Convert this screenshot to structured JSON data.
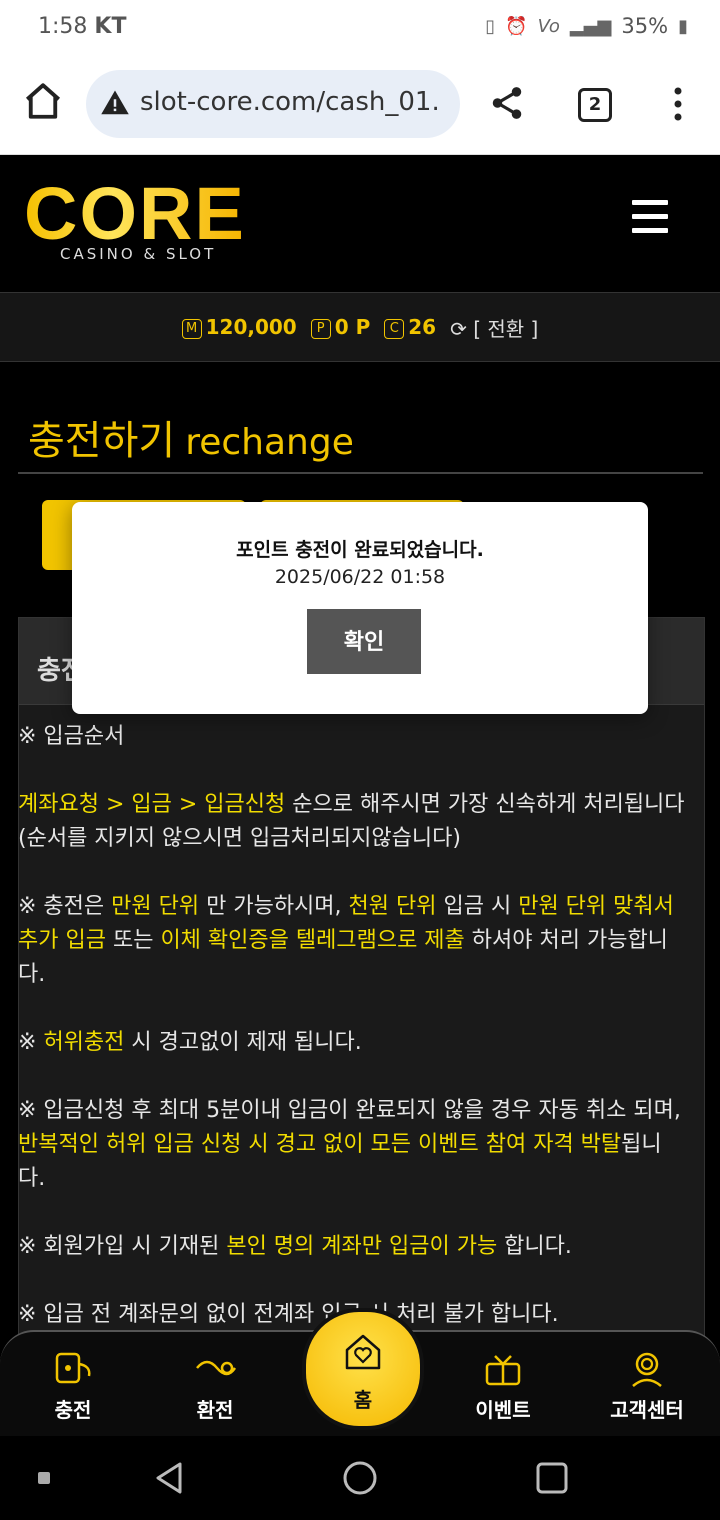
{
  "status_bar": {
    "time": "1:58",
    "carrier": "KT",
    "battery": "35%"
  },
  "browser": {
    "url": "slot-core.com/cash_01.",
    "tab_count": "2"
  },
  "site": {
    "logo_text": "CORE",
    "logo_sub": "CASINO & SLOT"
  },
  "money": {
    "m_value": "120,000",
    "p_value": "0 P",
    "c_value": "26",
    "convert": "[ 전환 ]"
  },
  "page": {
    "title": "충전하기",
    "title_en": "rechange",
    "panel_head": "충전"
  },
  "content": {
    "order_title": "※ 입금순서",
    "p1_y": "계좌요청 > 입금 > 입금신청",
    "p1_rest": " 순으로 해주시면 가장 신속하게 처리됩니다 (순서를 지키지 않으시면 입금처리되지않습니다)",
    "p2_a": "※ 충전은 ",
    "p2_y1": "만원 단위",
    "p2_b": " 만 가능하시며, ",
    "p2_y2": "천원 단위",
    "p2_c": " 입금 시 ",
    "p2_y3": "만원 단위 맞춰서 추가 입금",
    "p2_d": " 또는 ",
    "p2_y4": "이체 확인증을 텔레그램으로 제출",
    "p2_e": " 하셔야 처리 가능합니다.",
    "p3_a": "※ ",
    "p3_y": "허위충전",
    "p3_b": " 시 경고없이 제재 됩니다.",
    "p4_a": "※ 입금신청 후 최대 5분이내 입금이 완료되지 않을 경우 자동 취소 되며, ",
    "p4_y": "반복적인 허위 입금 신청 시 경고 없이 모든 이벤트 참여 자격 박탈",
    "p4_b": "됩니다.",
    "p5_a": "※ 회원가입 시 기재된 ",
    "p5_y": "본인 명의 계좌만 입금이 가능",
    "p5_b": " 합니다.",
    "p6": "※ 입금 전 계좌문의 없이 전계좌 입금 시 처리 불가 합니다."
  },
  "modal": {
    "message": "포인트 충전이 완료되었습니다.",
    "timestamp": "2025/06/22 01:58",
    "confirm_label": "확인"
  },
  "bottom_nav": {
    "charge": "충전",
    "exchange": "환전",
    "home": "홈",
    "event": "이벤트",
    "support": "고객센터"
  },
  "colors": {
    "accent": "#f1c400",
    "highlight": "#f1dc00",
    "background": "#000000"
  }
}
